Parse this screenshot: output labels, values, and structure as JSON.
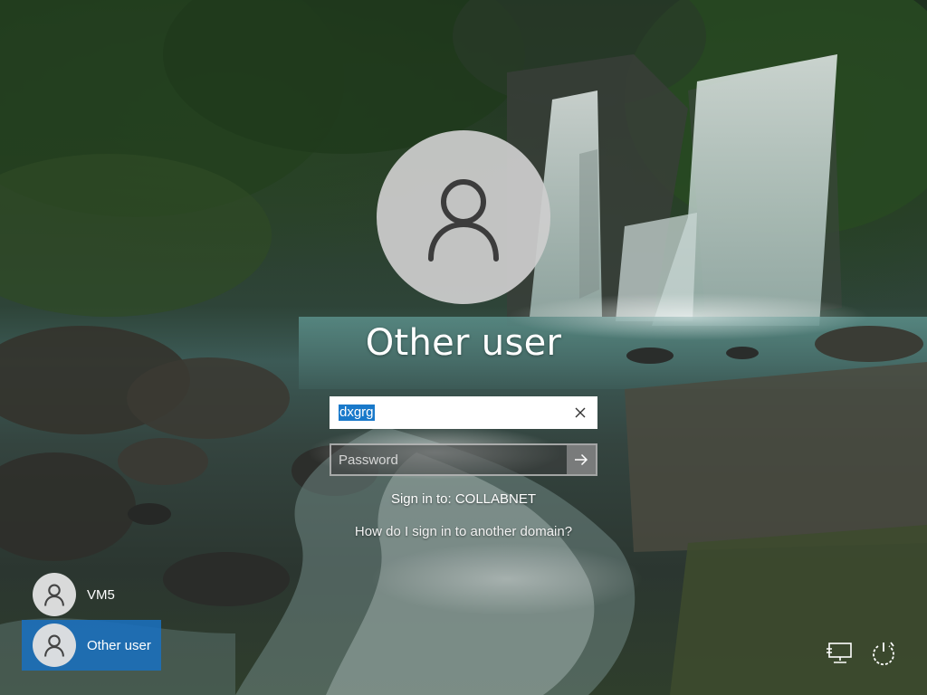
{
  "current_user": {
    "display_name": "Other user",
    "avatar_icon": "user-silhouette-icon"
  },
  "signin": {
    "username_value": "dxgrg",
    "clear_icon": "close-icon",
    "password_placeholder": "Password",
    "submit_icon": "arrow-right-icon",
    "sign_in_to": "Sign in to: COLLABNET",
    "domain_help_link": "How do I sign in to another domain?"
  },
  "users": [
    {
      "name": "VM5",
      "selected": false,
      "avatar_icon": "user-silhouette-icon"
    },
    {
      "name": "Other user",
      "selected": true,
      "avatar_icon": "user-silhouette-icon"
    }
  ],
  "corner_buttons": {
    "network_icon": "network-icon",
    "power_icon": "power-icon"
  },
  "colors": {
    "selection_accent": "#1a70be",
    "text_selection": "#1979ca",
    "avatar_background": "#cecece"
  }
}
